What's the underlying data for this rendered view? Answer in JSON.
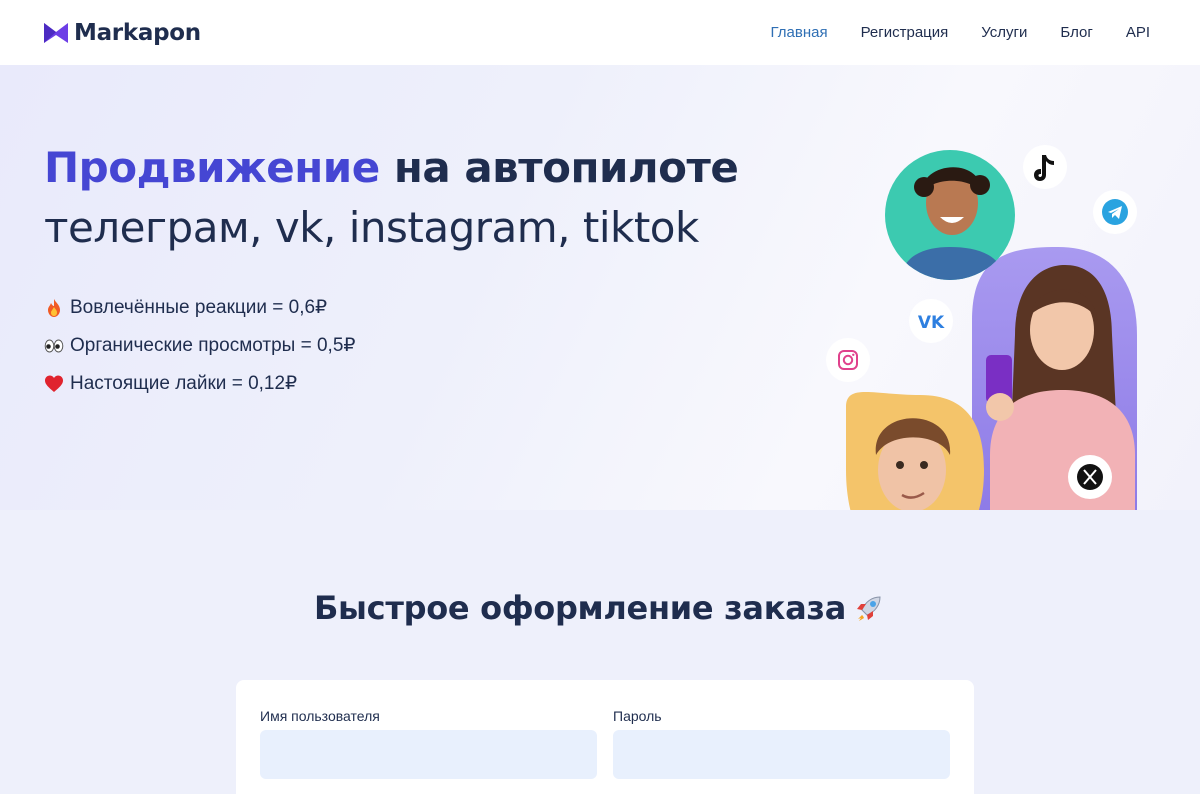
{
  "header": {
    "logo_text": "Markapon",
    "nav": [
      {
        "label": "Главная",
        "active": true
      },
      {
        "label": "Регистрация",
        "active": false
      },
      {
        "label": "Услуги",
        "active": false
      },
      {
        "label": "Блог",
        "active": false
      },
      {
        "label": "API",
        "active": false
      }
    ]
  },
  "hero": {
    "title_accent": "Продвижение",
    "title_rest": "на автопилоте",
    "subtitle": "телеграм, vk, instagram, tiktok",
    "features": [
      {
        "icon": "fire-icon",
        "text": "Вовлечённые реакции = 0,6₽"
      },
      {
        "icon": "eyes-icon",
        "text": "Органические просмотры = 0,5₽"
      },
      {
        "icon": "heart-icon",
        "text": "Настоящие лайки = 0,12₽"
      }
    ],
    "social_icons": [
      "tiktok-icon",
      "telegram-icon",
      "vk-icon",
      "instagram-icon",
      "x-icon"
    ]
  },
  "order": {
    "title": "Быстрое оформление заказа",
    "username_label": "Имя пользователя",
    "username_value": "",
    "password_label": "Пароль",
    "password_value": ""
  },
  "colors": {
    "accent": "#4546d3",
    "text": "#1f2d4e",
    "nav_active": "#2f6fb4",
    "input_bg": "#e8f0fd"
  }
}
